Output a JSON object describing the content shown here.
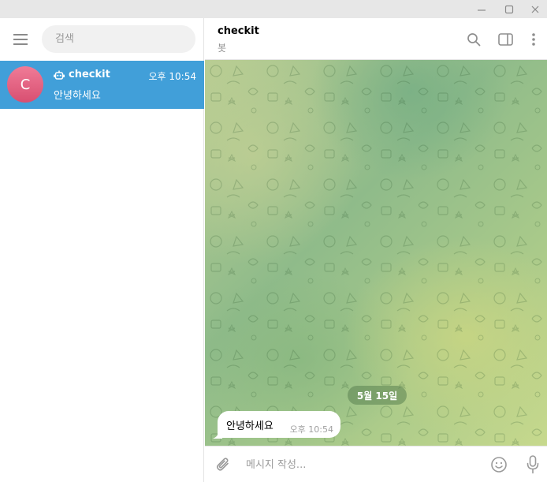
{
  "window_controls": {
    "minimize_icon": "minimize-icon",
    "maximize_icon": "maximize-icon",
    "close_icon": "close-icon"
  },
  "sidebar": {
    "menu_icon": "hamburger-menu-icon",
    "search": {
      "placeholder": "검색",
      "value": ""
    },
    "chats": [
      {
        "avatar_letter": "C",
        "name": "checkit",
        "badge_icon": "bot-icon",
        "time": "오후 10:54",
        "preview": "안녕하세요",
        "selected": true
      }
    ]
  },
  "header": {
    "title": "checkit",
    "status": "봇",
    "icons": [
      "search-icon",
      "sidebar-toggle-icon",
      "more-vertical-icon"
    ]
  },
  "messages": {
    "date_separator": "5월 15일",
    "items": [
      {
        "text": "안녕하세요",
        "time": "오후 10:54",
        "direction": "incoming"
      }
    ]
  },
  "composer": {
    "placeholder": "메시지 작성...",
    "value": "",
    "icons": [
      "paperclip-icon",
      "emoji-icon",
      "microphone-icon"
    ]
  },
  "colors": {
    "accent": "#419fd9",
    "avatar_gradient": [
      "#f07b97",
      "#d84f71"
    ],
    "wallpaper": "#a8c98a"
  }
}
